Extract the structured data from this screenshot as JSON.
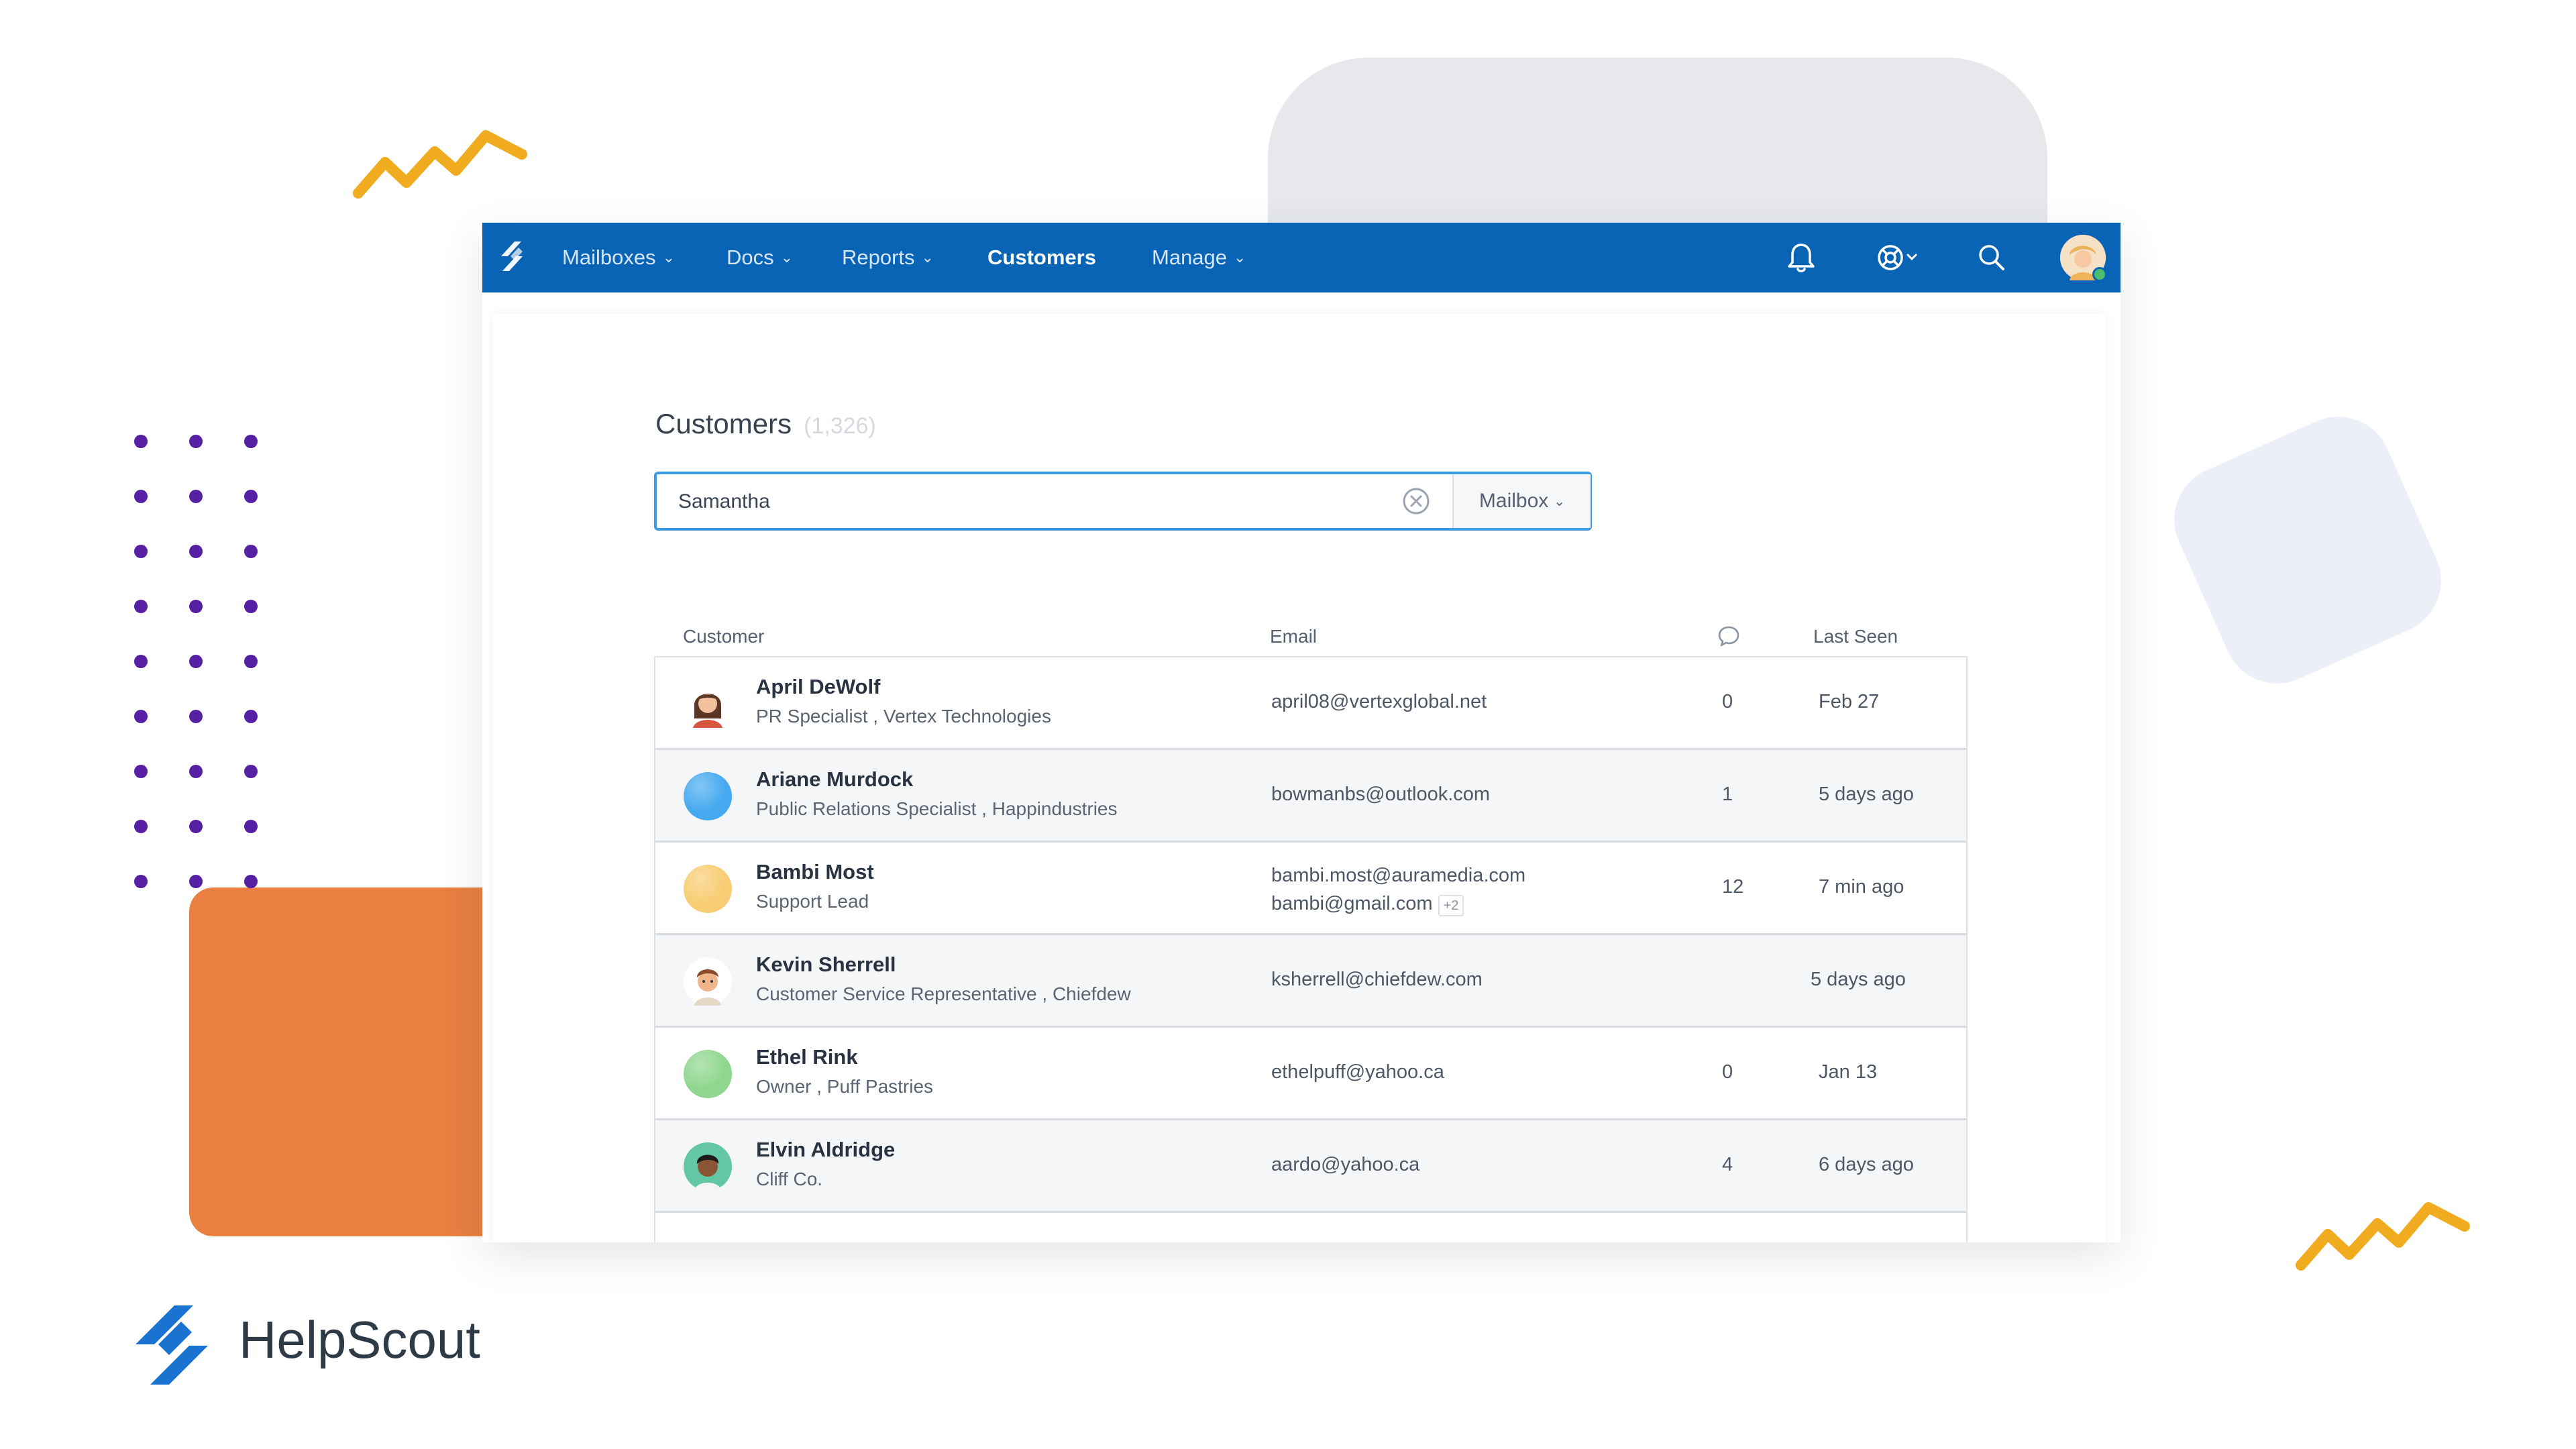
{
  "colors": {
    "nav_bg": "#0964b5",
    "accent_orange": "#e97f41",
    "dots_purple": "#5520a4",
    "zigzag_yellow": "#f0ab1f",
    "search_border": "#3b9ae1"
  },
  "nav": {
    "items": [
      {
        "label": "Mailboxes",
        "dropdown": true
      },
      {
        "label": "Docs",
        "dropdown": true
      },
      {
        "label": "Reports",
        "dropdown": true
      },
      {
        "label": "Customers",
        "dropdown": false,
        "active": true
      },
      {
        "label": "Manage",
        "dropdown": true
      }
    ],
    "icons": [
      "bell-icon",
      "help-lifebuoy-icon",
      "search-icon",
      "user-avatar"
    ]
  },
  "page": {
    "title": "Customers",
    "count": "(1,326)"
  },
  "search": {
    "value": "Samantha",
    "mailbox_label": "Mailbox"
  },
  "table": {
    "headers": {
      "customer": "Customer",
      "email": "Email",
      "conversations_icon": "chat-bubble-icon",
      "last_seen": "Last Seen"
    },
    "rows": [
      {
        "name": "April DeWolf",
        "title": "PR Specialist , Vertex Technologies",
        "emails": [
          "april08@vertexglobal.net"
        ],
        "extra": "",
        "convs": "0",
        "seen": "Feb 27",
        "avatar": "illustrated-woman",
        "color": ""
      },
      {
        "name": "Ariane Murdock",
        "title": "Public Relations Specialist , Happindustries",
        "emails": [
          "bowmanbs@outlook.com"
        ],
        "extra": "",
        "convs": "1",
        "seen": "5 days ago",
        "avatar": "color-circle",
        "color": "#46a9ef"
      },
      {
        "name": "Bambi Most",
        "title": "Support Lead",
        "emails": [
          "bambi.most@auramedia.com",
          "bambi@gmail.com"
        ],
        "extra": "+2",
        "convs": "12",
        "seen": "7 min ago",
        "avatar": "color-circle",
        "color": "#f8cc72"
      },
      {
        "name": "Kevin Sherrell",
        "title": "Customer Service Representative , Chiefdew",
        "emails": [
          "ksherrell@chiefdew.com"
        ],
        "extra": "",
        "convs": "",
        "seen": "5 days ago",
        "avatar": "illustrated-man",
        "color": ""
      },
      {
        "name": "Ethel Rink",
        "title": "Owner , Puff Pastries",
        "emails": [
          "ethelpuff@yahoo.ca"
        ],
        "extra": "",
        "convs": "0",
        "seen": "Jan 13",
        "avatar": "color-circle",
        "color": "#8fd68e"
      },
      {
        "name": "Elvin Aldridge",
        "title": "Cliff Co.",
        "emails": [
          "aardo@yahoo.ca"
        ],
        "extra": "",
        "convs": "4",
        "seen": "6 days ago",
        "avatar": "illustrated-man-dark",
        "color": ""
      }
    ]
  },
  "brand": {
    "name": "HelpScout"
  }
}
